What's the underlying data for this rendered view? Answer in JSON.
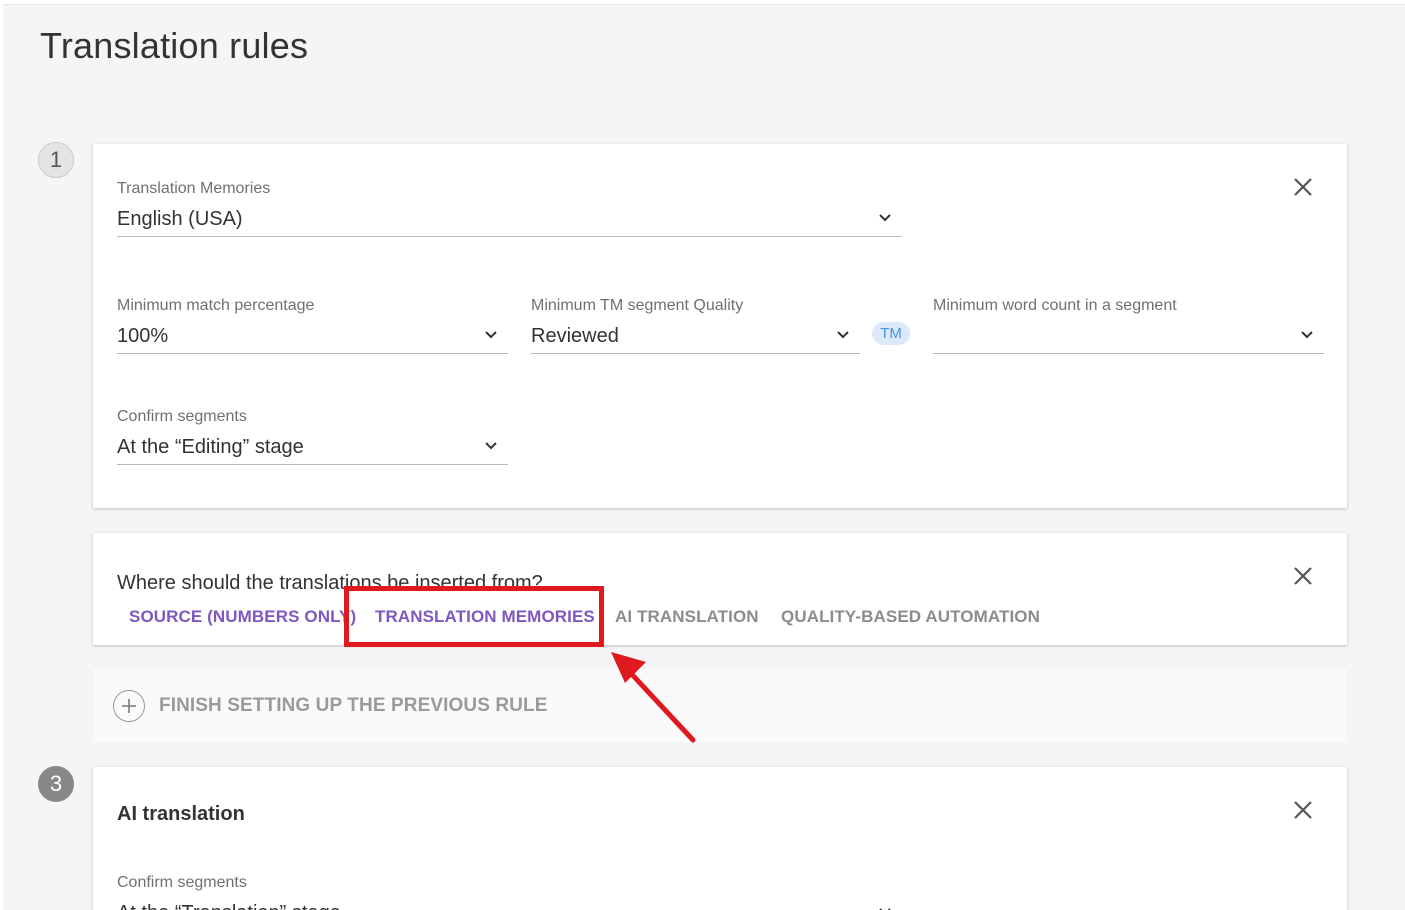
{
  "page": {
    "title": "Translation rules"
  },
  "rule1": {
    "step": "1",
    "tm": {
      "label": "Translation Memories",
      "value": "English (USA)"
    },
    "min_match": {
      "label": "Minimum match percentage",
      "value": "100%"
    },
    "min_quality": {
      "label": "Minimum TM segment Quality",
      "value": "Reviewed"
    },
    "tm_badge": "TM",
    "min_words": {
      "label": "Minimum word count in a segment",
      "value": ""
    },
    "confirm": {
      "label": "Confirm segments",
      "value": "At the “Editing” stage"
    }
  },
  "rule2": {
    "question": "Where should the translations be inserted from?",
    "tabs": [
      {
        "label": "SOURCE (NUMBERS ONLY)"
      },
      {
        "label": "TRANSLATION MEMORIES"
      },
      {
        "label": "AI TRANSLATION"
      },
      {
        "label": "QUALITY-BASED AUTOMATION"
      }
    ]
  },
  "add_rule": {
    "label": "FINISH SETTING UP THE PREVIOUS RULE"
  },
  "rule3": {
    "step": "3",
    "title": "AI translation",
    "confirm": {
      "label": "Confirm segments",
      "value": "At the “Translation” stage"
    }
  },
  "icons": {
    "close": "close-icon",
    "chevron": "chevron-down-icon",
    "add": "plus-icon",
    "annotation_arrow": "red-arrow"
  },
  "colors": {
    "accent": "#7e57c2",
    "annotation": "#e0191f",
    "badge_bg": "#dbe9fb",
    "badge_text": "#4a90e2"
  }
}
